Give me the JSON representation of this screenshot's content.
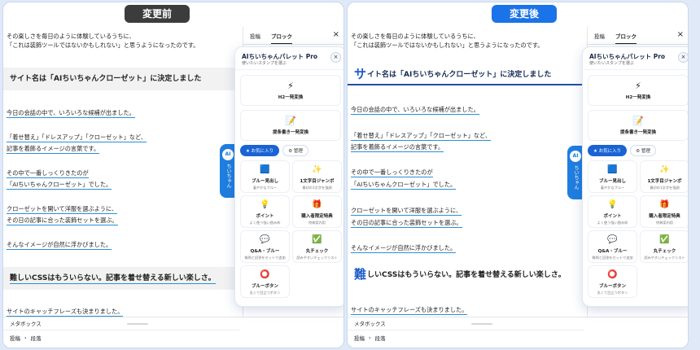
{
  "labels": {
    "before": "変更前",
    "after": "変更後"
  },
  "editor": {
    "line1": "その楽しさを毎日のように体験しているうちに、",
    "line2": "「これは装飾ツールではないかもしれない」と思うようになったのです。",
    "heading1": "サイト名は「AIちいちゃんクローゼット」に決定しました",
    "heading1_first": "サ",
    "heading1_rest": "イト名は「AIちいちゃんクローゼット」に決定しました",
    "p1": "今日の会話の中で、いろいろな候補が出ました。",
    "p2a": "「着せ替え」「ドレスアップ」「クローゼット」など、",
    "p2b": "記事を着飾るイメージの言葉です。",
    "p3a": "その中で一番しっくりきたのが",
    "p3b": "「AIちいちゃんクローゼット」でした。",
    "p4a": "クローゼットを開いて洋服を選ぶように、",
    "p4b": "その日の記事に合った装飾セットを選ぶ。",
    "p5": "そんなイメージが自然に浮かびました。",
    "heading2": "難しいCSSはもういらない。記事を着せ替える新しい楽しさ。",
    "heading2_first": "難",
    "heading2_rest": "しいCSSはもういらない。記事を着せ替える新しい楽しさ。",
    "p6": "サイトのキャッチフレーズも決まりました。"
  },
  "footer": {
    "metabox": "メタボックス",
    "crumb1": "投稿",
    "sep": "›",
    "crumb2": "段落"
  },
  "sidebar": {
    "tab1": "投稿",
    "tab2": "ブロック",
    "close": "×"
  },
  "ai_tab": {
    "badge": "AI",
    "vertical": "ちいちゃん"
  },
  "palette": {
    "title": "AIちいちゃんパレット Pro",
    "subtitle": "使いたいスタンプを選ぶ",
    "close": "×",
    "wide1": {
      "icon": "⚡",
      "label": "H2一発変換"
    },
    "wide2": {
      "icon": "📝",
      "label": "提条書き一発変換"
    },
    "chip_fav": "★ お気に入り",
    "chip_manage": "⚙ 管理",
    "items": [
      {
        "icon": "🟦",
        "name": "ブルー見出し",
        "desc": "着やかなブルー"
      },
      {
        "icon": "✨",
        "name": "1文字目ジャンボ",
        "desc": "最初の1文字を強調"
      },
      {
        "icon": "💡",
        "name": "ポイント",
        "desc": "よく使う強い囲み枠"
      },
      {
        "icon": "🎁",
        "name": "購入者限定特典",
        "desc": "特典案内用"
      },
      {
        "icon": "💬",
        "name": "Q&A・ブルー",
        "desc": "質問と回答をセットで追加"
      },
      {
        "icon": "✅",
        "name": "丸チェック",
        "desc": "読みやすいチェックリスト"
      },
      {
        "icon": "⭕",
        "name": "ブルーボタン",
        "desc": "丸くて目立つボタン"
      }
    ]
  },
  "colors": {
    "accent": "#1a73e8",
    "before_badge": "#3c3c3c",
    "underline": "#2a8fd6"
  }
}
